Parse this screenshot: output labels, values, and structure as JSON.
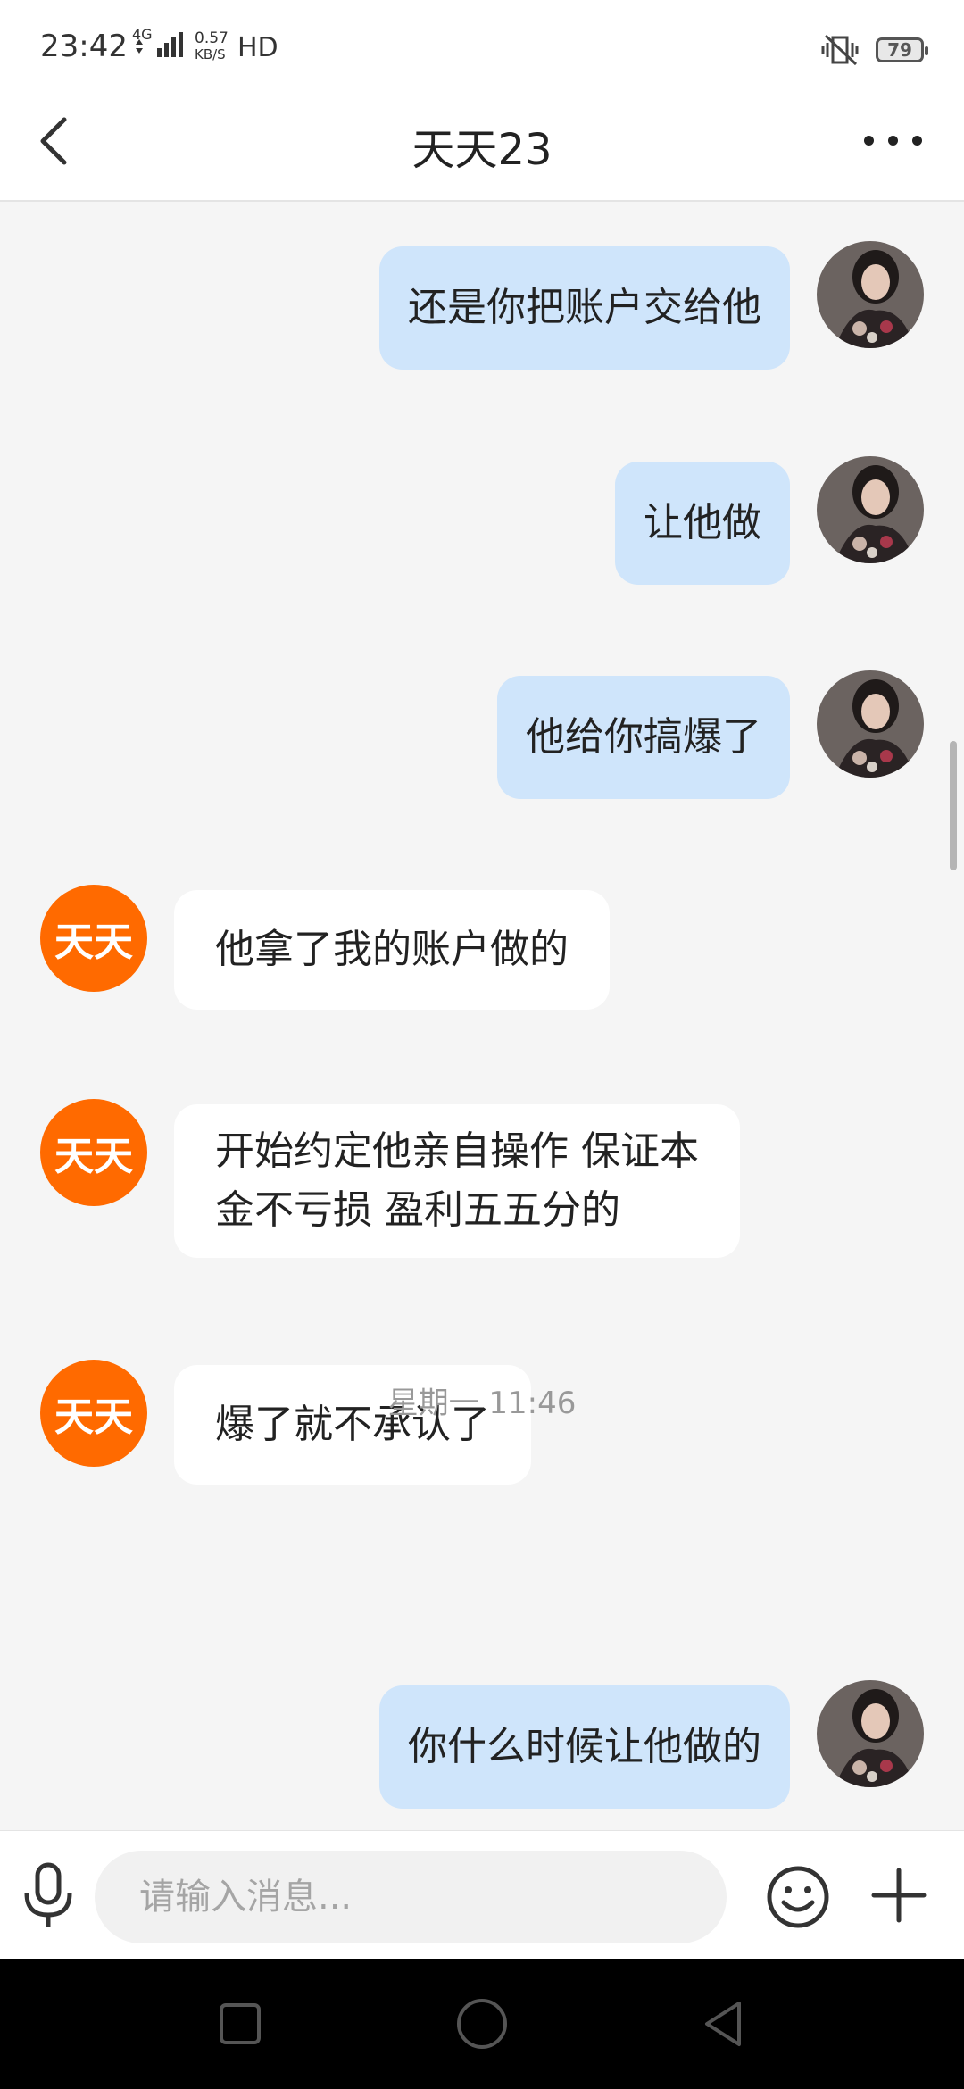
{
  "status_bar": {
    "time": "23:42",
    "network": "4G",
    "speed_value": "0.57",
    "speed_unit": "KB/S",
    "hd": "HD",
    "battery": "79"
  },
  "header": {
    "title": "天天23"
  },
  "messages": [
    {
      "side": "out",
      "text": "还是你把账户交给他"
    },
    {
      "side": "out",
      "text": "让他做"
    },
    {
      "side": "out",
      "text": "他给你搞爆了"
    },
    {
      "side": "in",
      "avatar_text": "天天",
      "text": "他拿了我的账户做的"
    },
    {
      "side": "in",
      "avatar_text": "天天",
      "text_line1": "开始约定他亲自操作 保证本",
      "text_line2": "金不亏损 盈利五五分的"
    },
    {
      "side": "in",
      "avatar_text": "天天",
      "text": "爆了就不承认了"
    },
    {
      "side": "out",
      "text": "你什么时候让他做的"
    }
  ],
  "time_divider": "星期一 11:46",
  "input": {
    "placeholder": "请输入消息..."
  },
  "icons": {
    "back": "back-arrow-icon",
    "more": "more-dots-icon",
    "mic": "microphone-icon",
    "emoji": "emoji-icon",
    "plus": "plus-icon",
    "mute": "vibrate-off-icon"
  },
  "colors": {
    "outgoing_bubble": "#cfe5fb",
    "incoming_bubble": "#ffffff",
    "avatar_orange": "#ff6a00",
    "chat_background": "#f5f5f5"
  }
}
